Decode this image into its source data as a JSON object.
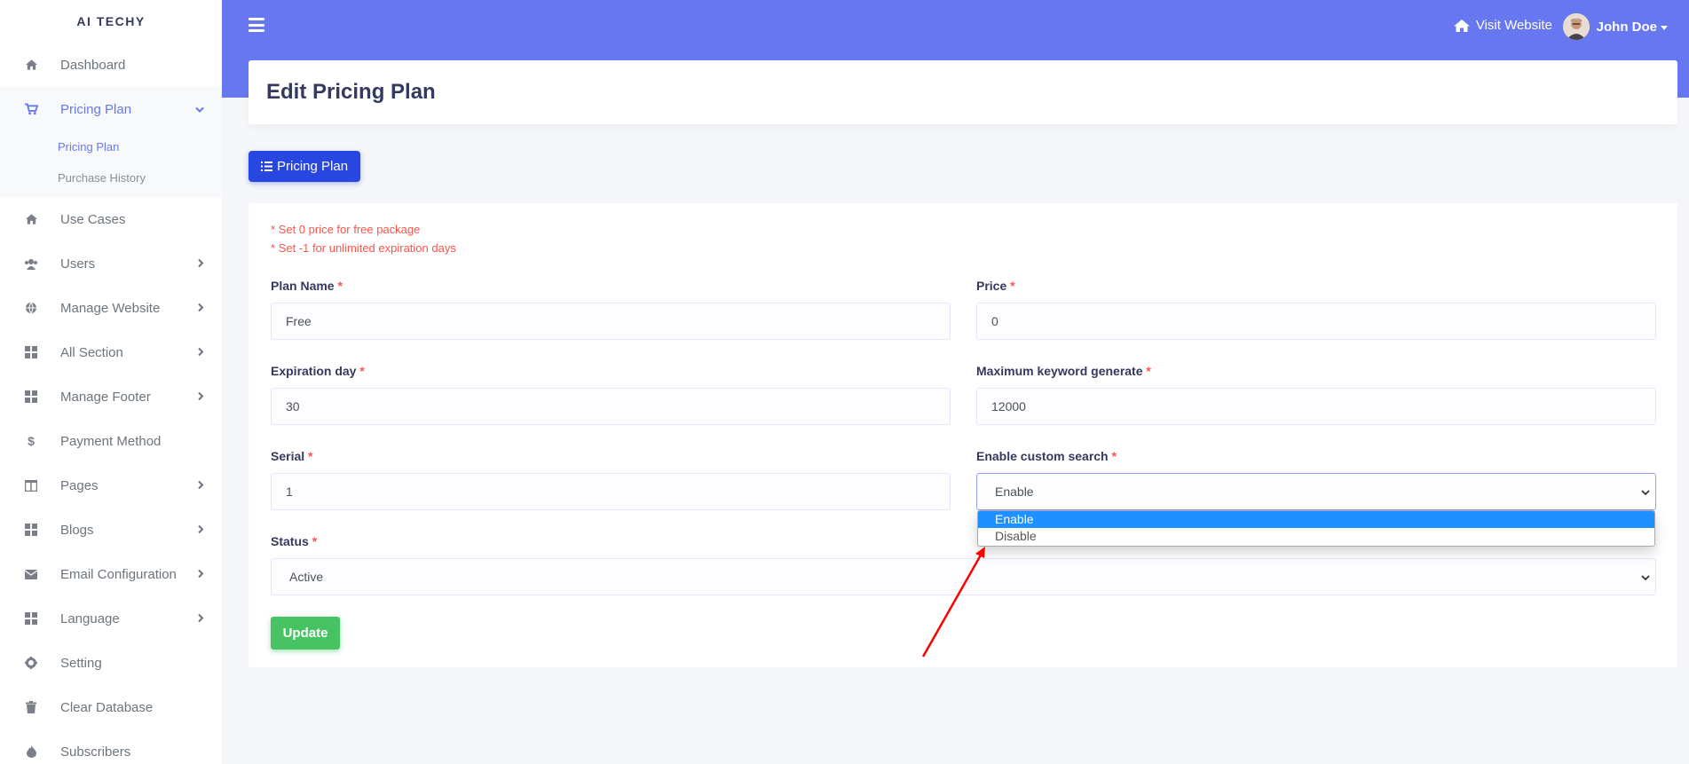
{
  "brand": "AI TECHY",
  "sidebar": {
    "items": [
      {
        "label": "Dashboard",
        "icon": "home-icon"
      },
      {
        "label": "Pricing Plan",
        "icon": "cart-icon"
      },
      {
        "label": "Use Cases",
        "icon": "home-icon"
      },
      {
        "label": "Users",
        "icon": "users-icon"
      },
      {
        "label": "Manage Website",
        "icon": "globe-icon"
      },
      {
        "label": "All Section",
        "icon": "grid-icon"
      },
      {
        "label": "Manage Footer",
        "icon": "grid-icon"
      },
      {
        "label": "Payment Method",
        "icon": "dollar-icon"
      },
      {
        "label": "Pages",
        "icon": "columns-icon"
      },
      {
        "label": "Blogs",
        "icon": "grid-icon"
      },
      {
        "label": "Email Configuration",
        "icon": "envelope-icon"
      },
      {
        "label": "Language",
        "icon": "grid-icon"
      },
      {
        "label": "Setting",
        "icon": "gear-icon"
      },
      {
        "label": "Clear Database",
        "icon": "trash-icon"
      },
      {
        "label": "Subscribers",
        "icon": "fire-icon"
      }
    ],
    "submenu": [
      "Pricing Plan",
      "Purchase History"
    ]
  },
  "topbar": {
    "visit_label": "Visit Website",
    "user_name": "John Doe"
  },
  "page": {
    "title": "Edit Pricing Plan",
    "back_button": "Pricing Plan"
  },
  "form": {
    "notes": [
      "* Set 0 price for free package",
      "* Set -1 for unlimited expiration days"
    ],
    "plan_name": {
      "label": "Plan Name",
      "value": "Free"
    },
    "price": {
      "label": "Price",
      "value": "0"
    },
    "expiration_day": {
      "label": "Expiration day",
      "value": "30"
    },
    "max_keyword": {
      "label": "Maximum keyword generate",
      "value": "12000"
    },
    "serial": {
      "label": "Serial",
      "value": "1"
    },
    "custom_search": {
      "label": "Enable custom search",
      "value": "Enable",
      "options": [
        "Enable",
        "Disable"
      ]
    },
    "status": {
      "label": "Status",
      "value": "Active"
    },
    "required_mark": "*",
    "update_label": "Update"
  },
  "colors": {
    "accent": "#6777ef",
    "primary_button": "#2846e0",
    "success": "#47c363",
    "danger": "#fc544b",
    "annotation_arrow": "#ff0000"
  }
}
